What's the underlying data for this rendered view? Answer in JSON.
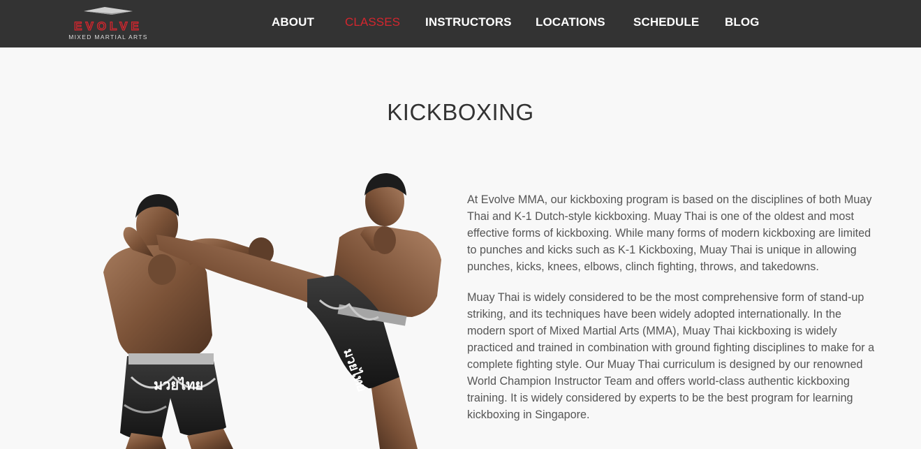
{
  "brand": {
    "logo_main": "EVOLVE",
    "logo_sub": "MIXED MARTIAL ARTS",
    "accent": "#d4262e"
  },
  "nav": {
    "items": [
      {
        "label": "ABOUT",
        "active": false
      },
      {
        "label": "CLASSES",
        "active": true
      },
      {
        "label": "INSTRUCTORS",
        "active": false
      },
      {
        "label": "LOCATIONS",
        "active": false
      },
      {
        "label": "SCHEDULE",
        "active": false
      },
      {
        "label": "BLOG",
        "active": false
      }
    ],
    "background": "#333333"
  },
  "page": {
    "title": "KICKBOXING",
    "paragraphs": [
      "At Evolve MMA, our kickboxing program is based on the disciplines of both Muay Thai and K-1 Dutch-style kickboxing. Muay Thai is one of the oldest and most effective forms of kickboxing. While many forms of modern kickboxing are limited to punches and kicks such as K-1 Kickboxing, Muay Thai is unique in allowing punches, kicks, knees, elbows, clinch fighting, throws, and takedowns.",
      "Muay Thai is widely considered to be the most comprehensive form of stand-up striking, and its techniques have been widely adopted internationally. In the modern sport of Mixed Martial Arts (MMA), Muay Thai kickboxing is widely practiced and trained in combination with ground fighting disciplines to make for a complete fighting style. Our Muay Thai curriculum is designed by our renowned World Champion Instructor Team and offers world-class authentic kickboxing training. It is widely considered by experts to be the best program for learning kickboxing in Singapore."
    ]
  },
  "hero_image": {
    "shorts_text_left": "มวยไทย",
    "shorts_text_right": "มวยไทย"
  }
}
